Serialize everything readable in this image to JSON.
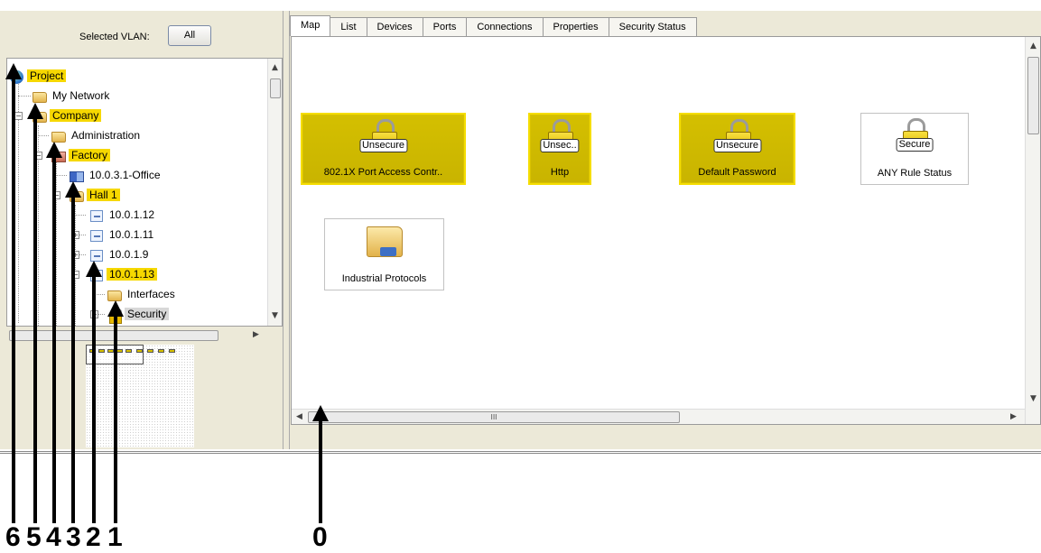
{
  "vlan": {
    "label": "Selected VLAN:",
    "button": "All"
  },
  "tree": {
    "project": "Project",
    "my_network": "My Network",
    "company": "Company",
    "administration": "Administration",
    "factory": "Factory",
    "office": "10.0.3.1-Office",
    "hall": "Hall 1",
    "ip1": "10.0.1.12",
    "ip2": "10.0.1.11",
    "ip3": "10.0.1.9",
    "ip4": "10.0.1.13",
    "interfaces": "Interfaces",
    "security": "Security"
  },
  "tabs": [
    "Map",
    "List",
    "Devices",
    "Ports",
    "Connections",
    "Properties",
    "Security Status"
  ],
  "cards": [
    {
      "badge": "Unsecure",
      "caption": "802.1X Port Access Contr.."
    },
    {
      "badge": "Unsec..",
      "caption": "Http"
    },
    {
      "badge": "Unsecure",
      "caption": "Default Password"
    },
    {
      "badge": "Secure",
      "caption": "ANY Rule Status"
    },
    {
      "caption": "Industrial Protocols"
    }
  ],
  "scroll": {
    "hthumb": "III"
  },
  "markers": [
    "6",
    "5",
    "4",
    "3",
    "2",
    "1",
    "0"
  ],
  "colors": {
    "highlight": "#f6d800",
    "unsecure_tile": "#d4bf00"
  }
}
